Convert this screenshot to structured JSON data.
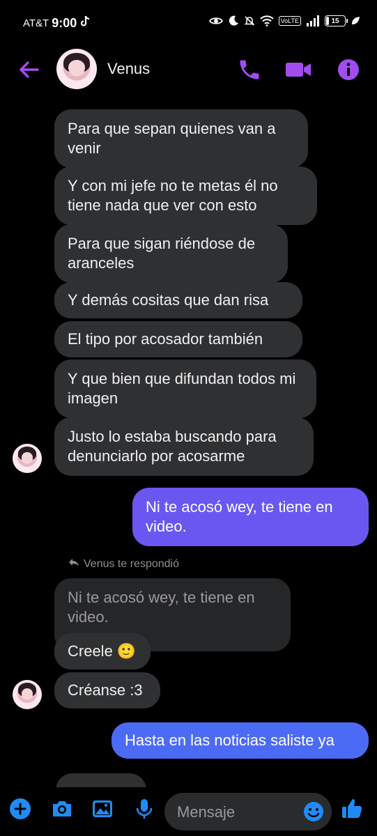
{
  "status_bar": {
    "carrier": "AT&T",
    "time": "9:00",
    "volte": "VoLTE",
    "battery": "15"
  },
  "header": {
    "contact_name": "Venus",
    "icons": [
      "back-arrow-icon",
      "phone-icon",
      "video-camera-icon",
      "info-icon"
    ]
  },
  "messages": [
    {
      "direction": "in",
      "text": "Para que sepan quienes van a venir"
    },
    {
      "direction": "in",
      "text": "Y con mi jefe no te metas él no tiene nada que ver con esto"
    },
    {
      "direction": "in",
      "text": "Para que sigan riéndose de aranceles"
    },
    {
      "direction": "in",
      "text": "Y demás cositas que dan risa"
    },
    {
      "direction": "in",
      "text": "El tipo por acosador también"
    },
    {
      "direction": "in",
      "text": "Y que bien que difundan todos mi imagen"
    },
    {
      "direction": "in",
      "text": "Justo lo estaba buscando para denunciarlo por acosarme"
    },
    {
      "direction": "out",
      "text": "Ni te acosó wey, te tiene en video."
    },
    {
      "direction": "in",
      "text": "Ni te acosó wey, te tiene en video.",
      "quoted": true
    },
    {
      "direction": "in",
      "text": "Creele 🙂"
    },
    {
      "direction": "in",
      "text": "Créanse :3"
    },
    {
      "direction": "out",
      "text": "Hasta en las noticias saliste ya"
    }
  ],
  "reply_note": "Venus te respondió",
  "composer": {
    "placeholder": "Mensaje",
    "icons": [
      "plus-icon",
      "camera-icon",
      "gallery-icon",
      "microphone-icon",
      "emoji-icon",
      "thumbs-up-icon"
    ]
  },
  "colors": {
    "accent": "#a24cf0",
    "incoming_bubble": "#2f3032",
    "outgoing_bubble": "#6a57f2",
    "icon_blue": "#1f8cf5"
  }
}
